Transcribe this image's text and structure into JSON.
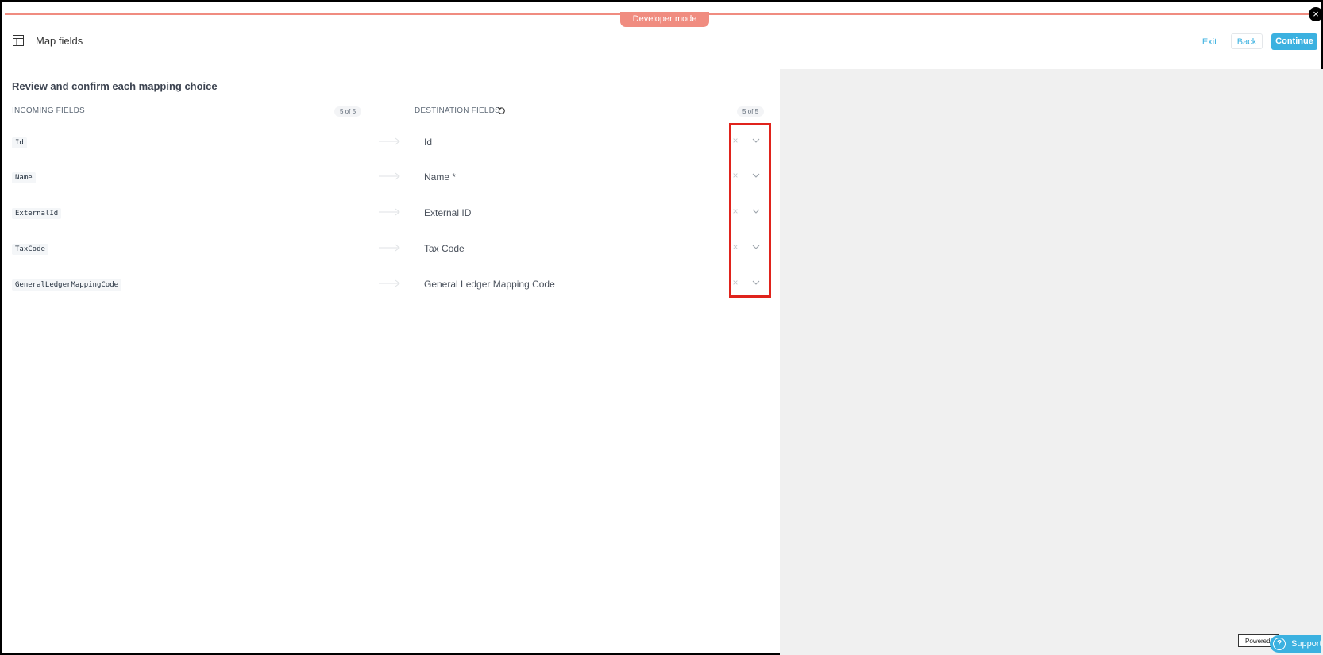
{
  "banner": {
    "developer_mode": "Developer mode",
    "close_glyph": "×"
  },
  "header": {
    "icon": "table-icon",
    "title": "Map fields",
    "exit_label": "Exit",
    "back_label": "Back",
    "continue_label": "Continue"
  },
  "mapping": {
    "section_title": "Review and confirm each mapping choice",
    "incoming_header": "INCOMING FIELDS",
    "incoming_count": "5 of 5",
    "destination_header": "DESTINATION FIELDS",
    "destination_count": "5 of 5",
    "rows": [
      {
        "source": "Id",
        "destination": "Id"
      },
      {
        "source": "Name",
        "destination": "Name *"
      },
      {
        "source": "ExternalId",
        "destination": "External ID"
      },
      {
        "source": "TaxCode",
        "destination": "Tax Code"
      },
      {
        "source": "GeneralLedgerMappingCode",
        "destination": "General Ledger Mapping Code"
      }
    ],
    "clear_glyph": "×"
  },
  "footer": {
    "powered_label": "Powered",
    "support_label": "Support",
    "support_glyph": "?"
  },
  "colors": {
    "accent": "#3bb1e0",
    "dev_banner": "#f08c80",
    "highlight": "#e0231c",
    "panel": "#f0f0f0"
  }
}
